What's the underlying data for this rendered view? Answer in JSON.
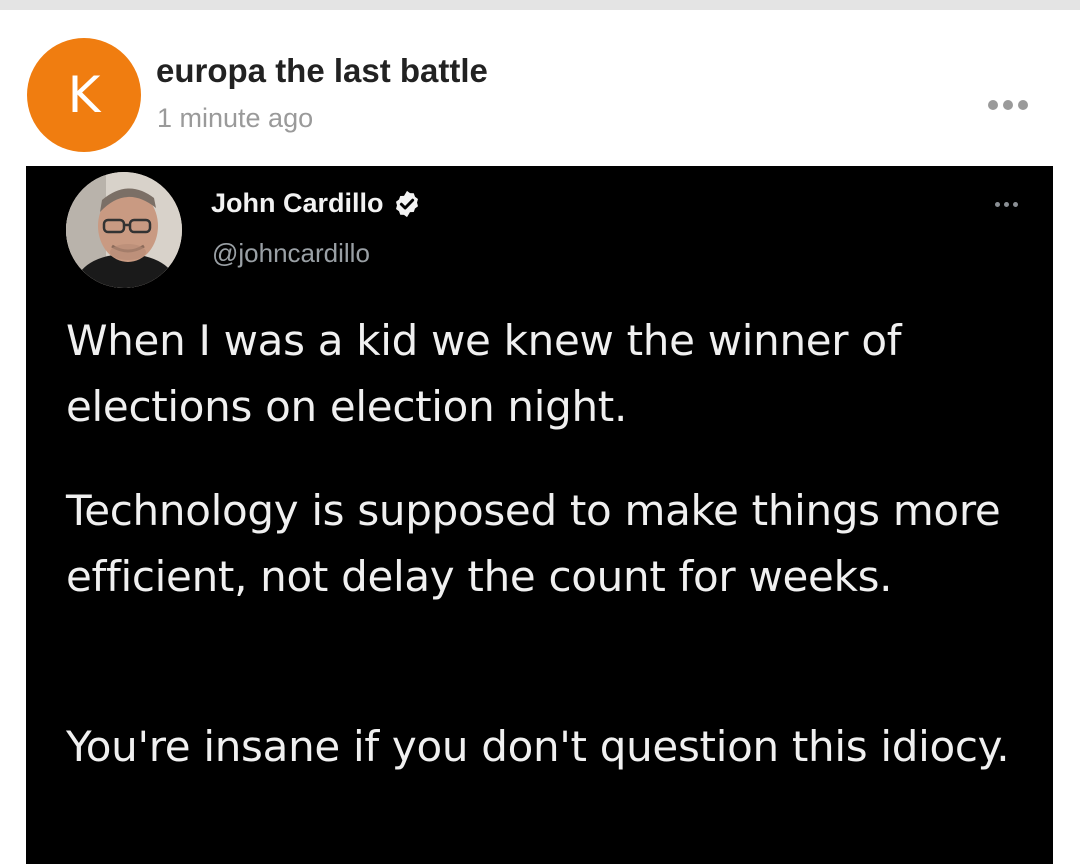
{
  "post": {
    "avatar_letter": "K",
    "author": "europa the last battle",
    "timestamp": "1 minute ago",
    "more_icon": "more-horizontal-icon",
    "accent_color": "#f07d10"
  },
  "tweet": {
    "name": "John Cardillo",
    "handle": "@johncardillo",
    "verified_icon": "verified-badge-icon",
    "paragraphs": [
      "When I was a kid we knew the winner of elections on election night.",
      "Technology is supposed to make things more efficient, not delay the count for weeks.",
      "You're insane if you don't question this idiocy."
    ]
  }
}
